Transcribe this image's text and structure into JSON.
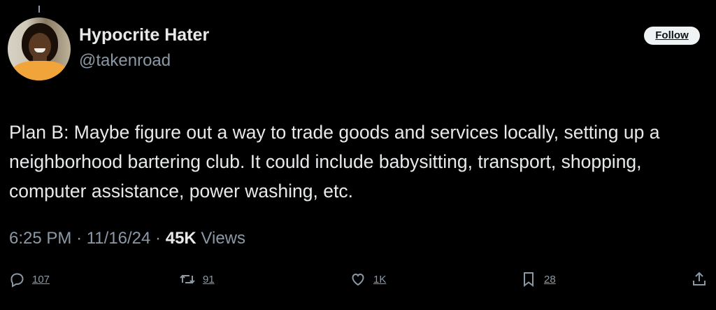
{
  "user": {
    "display_name": "Hypocrite Hater",
    "handle": "@takenroad"
  },
  "follow_label": "Follow",
  "tweet": {
    "text": "Plan B: Maybe figure out a way to trade goods and services locally, setting up a neighborhood bartering club. It could include babysitting, transport, shopping, computer assistance, power washing, etc."
  },
  "meta": {
    "time": "6:25 PM",
    "separator": "·",
    "date": "11/16/24",
    "views_count": "45K",
    "views_label": "Views"
  },
  "actions": {
    "reply_count": "107",
    "retweet_count": "91",
    "like_count": "1K",
    "bookmark_count": "28"
  },
  "icons": {
    "reply": "reply-icon",
    "retweet": "retweet-icon",
    "like": "heart-icon",
    "bookmark": "bookmark-icon",
    "share": "share-icon"
  },
  "colors": {
    "background": "#000000",
    "text_primary": "#e7e9ea",
    "text_secondary": "#8b98a5",
    "follow_bg": "#eff3f4"
  }
}
